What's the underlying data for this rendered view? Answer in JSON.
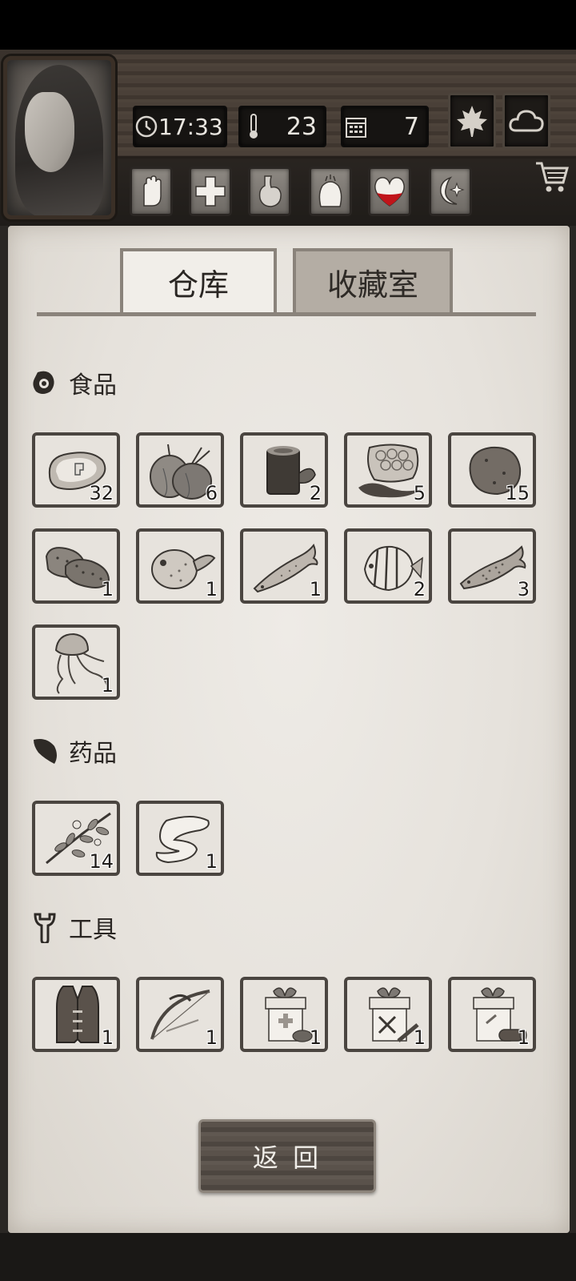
{
  "hud": {
    "time": "17:33",
    "temperature": "23",
    "day": "7",
    "season_icon": "maple-leaf-icon",
    "weather_icon": "cloud-icon"
  },
  "status_icons": [
    "hand-icon",
    "health-cross-icon",
    "stomach-icon",
    "mind-icon",
    "heart-icon",
    "moon-icon"
  ],
  "tabs": {
    "warehouse": "仓库",
    "collection": "收藏室"
  },
  "sections": {
    "food": {
      "title": "食品",
      "items": [
        {
          "icon": "meat-icon",
          "qty": "32"
        },
        {
          "icon": "onion-icon",
          "qty": "6"
        },
        {
          "icon": "tea-cup-icon",
          "qty": "2"
        },
        {
          "icon": "honeycomb-icon",
          "qty": "5"
        },
        {
          "icon": "potato-icon",
          "qty": "15"
        },
        {
          "icon": "sea-cucumber-icon",
          "qty": "1"
        },
        {
          "icon": "pufferfish-icon",
          "qty": "1"
        },
        {
          "icon": "salmon-icon",
          "qty": "1"
        },
        {
          "icon": "butterflyfish-icon",
          "qty": "2"
        },
        {
          "icon": "cod-icon",
          "qty": "3"
        },
        {
          "icon": "jellyfish-icon",
          "qty": "1"
        }
      ]
    },
    "medicine": {
      "title": "药品",
      "items": [
        {
          "icon": "herb-icon",
          "qty": "14"
        },
        {
          "icon": "bandage-icon",
          "qty": "1"
        }
      ]
    },
    "tools": {
      "title": "工具",
      "items": [
        {
          "icon": "vest-icon",
          "qty": "1"
        },
        {
          "icon": "bow-icon",
          "qty": "1"
        },
        {
          "icon": "medical-gift-box-icon",
          "qty": "1"
        },
        {
          "icon": "tool-gift-box-icon",
          "qty": "1"
        },
        {
          "icon": "wood-gift-box-icon",
          "qty": "1"
        }
      ]
    }
  },
  "back_button": "返 回"
}
